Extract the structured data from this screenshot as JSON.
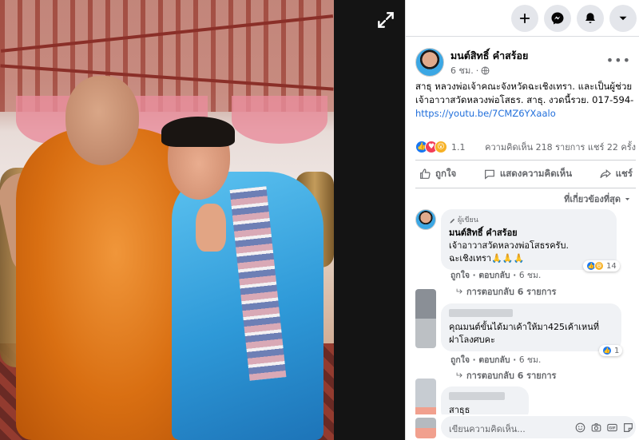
{
  "post": {
    "author": "มนต์สิทธิ์ คำสร้อย",
    "time": "6 ชม.",
    "dot": "·",
    "text": "สาธุ หลวงพ่อเจ้าคณะจังหวัดฉะเชิงเทรา. และเป็นผู้ช่วยเจ้าอาวาสวัดหลวงพ่อโสธร. สาธุ. งวดนี้รวย. 017-594-",
    "link": "https://youtu.be/7CMZ6YXaalo",
    "reaction_count": "1.1",
    "stats": "ความคิดเห็น 218 รายการ  แชร์ 22 ครั้ง"
  },
  "actions": {
    "like": "ถูกใจ",
    "comment": "แสดงความคิดเห็น",
    "share": "แชร์"
  },
  "sort_label": "ที่เกี่ยวข้องที่สุด",
  "comments": [
    {
      "badge": "ผู้เขียน",
      "name": "มนต์สิทธิ์ คำสร้อย",
      "line1": "เจ้าอาวาสวัดหลวงพ่อโสธรครับ.",
      "line2": "ฉะเชิงเทรา🙏🙏🙏",
      "like": "ถูกใจ",
      "reply": "ตอบกลับ",
      "time": "6 ชม.",
      "reactions": "14",
      "replies": "การตอบกลับ 6 รายการ"
    },
    {
      "line1": "คุณมนต์ขั้นได้มาเค้าให้มา425เค้าเหนที่",
      "line2": "ฝาโลงศบคะ",
      "like": "ถูกใจ",
      "reply": "ตอบกลับ",
      "time": "6 ชม.",
      "reactions": "1",
      "replies": "การตอบกลับ 6 รายการ"
    },
    {
      "partial_name": "สาธุธ"
    }
  ],
  "composer": {
    "placeholder": "เขียนความคิดเห็น..."
  },
  "colors": {
    "link": "#216fdb",
    "like_blue": "#1877f2",
    "love_red": "#f33e58",
    "wow_yellow": "#f7b125",
    "bubble_bg": "#f0f2f5"
  },
  "icons": {
    "expand": "expand-icon",
    "add": "plus-icon",
    "messenger": "messenger-icon",
    "notifications": "bell-icon",
    "account": "caret-down-icon"
  }
}
